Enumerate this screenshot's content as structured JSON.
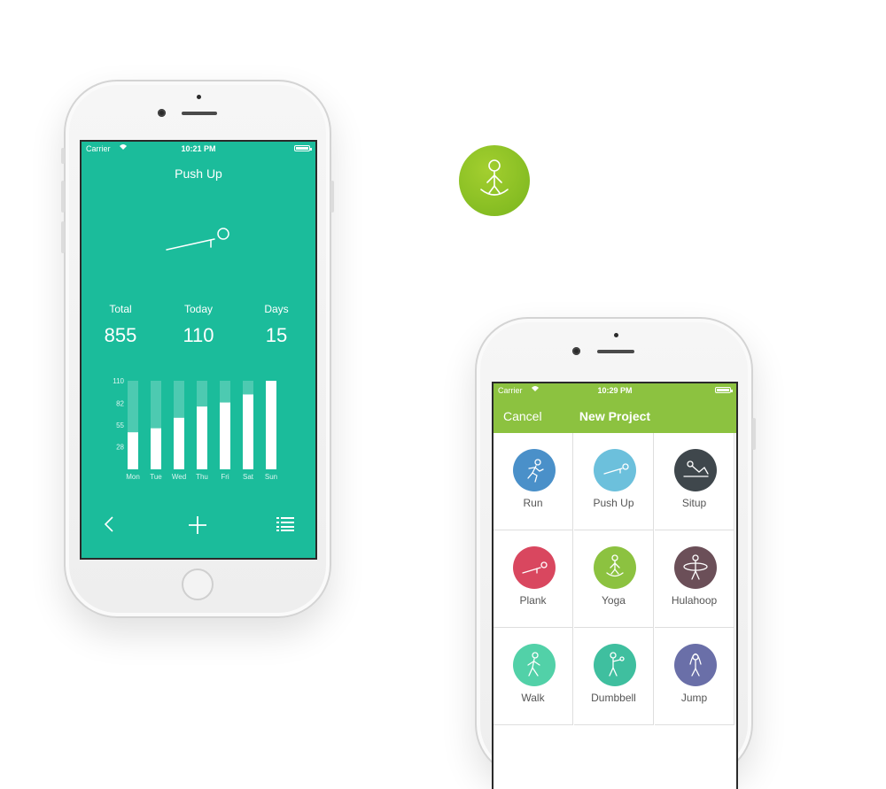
{
  "colors": {
    "teal": "#1bbc9b",
    "green_nav": "#8cc240",
    "logo_green": "#86bd22"
  },
  "logo": {
    "icon": "yoga-meditation-icon"
  },
  "phone1": {
    "status": {
      "carrier": "Carrier",
      "time": "10:21 PM"
    },
    "title": "Push Up",
    "hero_icon": "push-up-icon",
    "stats": [
      {
        "label": "Total",
        "value": "855"
      },
      {
        "label": "Today",
        "value": "110"
      },
      {
        "label": "Days",
        "value": "15"
      }
    ],
    "toolbar": {
      "back_icon": "chevron-left-icon",
      "add_icon": "plus-icon",
      "list_icon": "list-icon"
    }
  },
  "chart_data": {
    "type": "bar",
    "categories": [
      "Mon",
      "Tue",
      "Wed",
      "Thu",
      "Fri",
      "Sat",
      "Sun"
    ],
    "series": [
      {
        "values": [
          46,
          51,
          64,
          78,
          83,
          93,
          110
        ]
      }
    ],
    "ytick_labels": [
      "110",
      "82",
      "55",
      "28"
    ],
    "ylim": [
      0,
      110
    ],
    "title": "",
    "xlabel": "",
    "ylabel": ""
  },
  "phone2": {
    "status": {
      "carrier": "Carrier",
      "time": "10:29 PM"
    },
    "nav": {
      "cancel": "Cancel",
      "title": "New Project"
    },
    "items": [
      {
        "name": "Run",
        "color": "#4a90c9",
        "icon": "run-icon"
      },
      {
        "name": "Push Up",
        "color": "#6cc0dc",
        "icon": "push-up-icon"
      },
      {
        "name": "Situp",
        "color": "#3f474c",
        "icon": "situp-icon"
      },
      {
        "name": "Plank",
        "color": "#d9475f",
        "icon": "plank-icon"
      },
      {
        "name": "Yoga",
        "color": "#8cc240",
        "icon": "yoga-icon"
      },
      {
        "name": "Hulahoop",
        "color": "#6b4f58",
        "icon": "hulahoop-icon"
      },
      {
        "name": "Walk",
        "color": "#52d1a8",
        "icon": "walk-icon"
      },
      {
        "name": "Dumbbell",
        "color": "#3fbf9f",
        "icon": "dumbbell-icon"
      },
      {
        "name": "Jump",
        "color": "#6a6fa8",
        "icon": "jump-rope-icon"
      }
    ]
  }
}
